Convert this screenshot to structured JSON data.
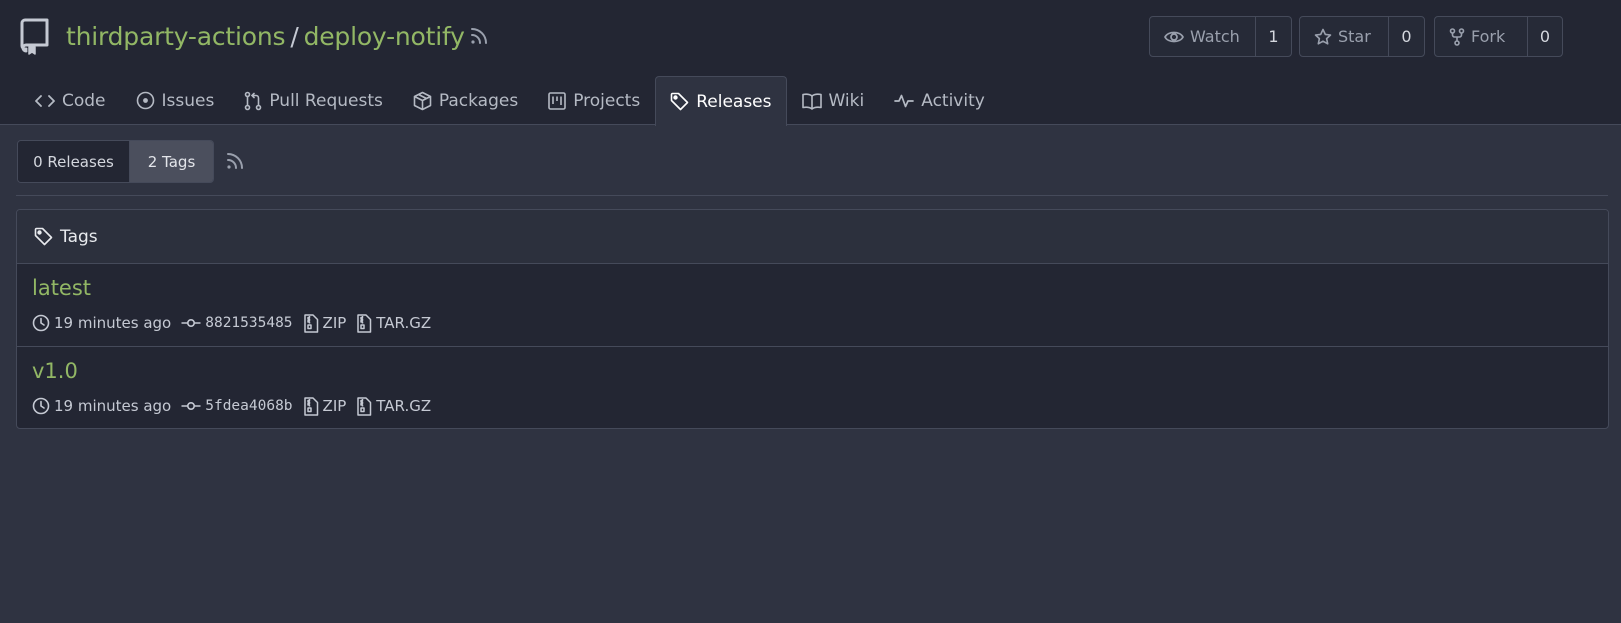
{
  "repo": {
    "owner": "thirdparty-actions",
    "separator": "/",
    "name": "deploy-notify"
  },
  "actions": {
    "watch": {
      "label": "Watch",
      "count": "1"
    },
    "star": {
      "label": "Star",
      "count": "0"
    },
    "fork": {
      "label": "Fork",
      "count": "0"
    }
  },
  "tabs": [
    {
      "label": "Code",
      "icon": "code-icon"
    },
    {
      "label": "Issues",
      "icon": "issue-icon"
    },
    {
      "label": "Pull Requests",
      "icon": "pull-request-icon"
    },
    {
      "label": "Packages",
      "icon": "package-icon"
    },
    {
      "label": "Projects",
      "icon": "project-icon"
    },
    {
      "label": "Releases",
      "icon": "tag-icon",
      "active": true
    },
    {
      "label": "Wiki",
      "icon": "book-icon"
    },
    {
      "label": "Activity",
      "icon": "pulse-icon"
    }
  ],
  "toggle": {
    "releases_label": "0 Releases",
    "tags_label": "2 Tags"
  },
  "tags_panel": {
    "title": "Tags",
    "items": [
      {
        "name": "latest",
        "time": "19 minutes ago",
        "sha": "8821535485",
        "zip": "ZIP",
        "targz": "TAR.GZ"
      },
      {
        "name": "v1.0",
        "time": "19 minutes ago",
        "sha": "5fdea4068b",
        "zip": "ZIP",
        "targz": "TAR.GZ"
      }
    ]
  },
  "colors": {
    "link_green": "#92b765",
    "background": "#2f3341",
    "header_bg": "#232633",
    "border": "#454a5a"
  }
}
